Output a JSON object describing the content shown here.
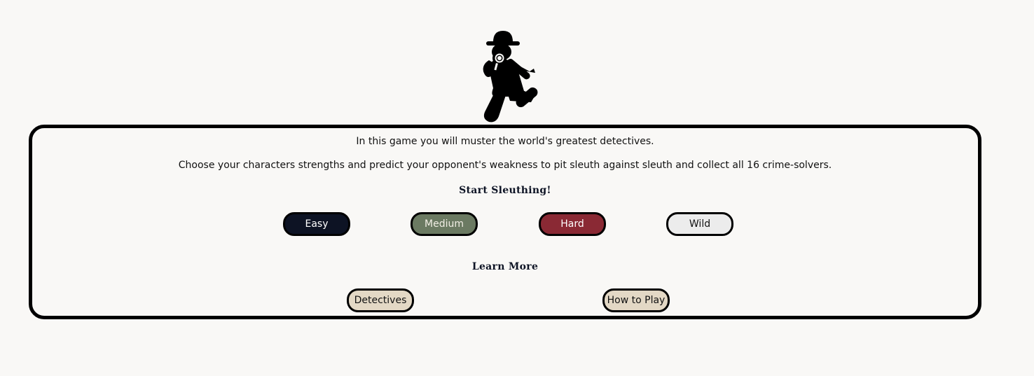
{
  "intro": {
    "line1": "In this game you will muster the world's greatest detectives.",
    "line2": "Choose your characters strengths and predict your opponent's weakness to pit sleuth against sleuth and collect all 16 crime-solvers."
  },
  "start": {
    "heading": "Start Sleuthing!",
    "difficulties": [
      {
        "label": "Easy",
        "color": "#0d1324"
      },
      {
        "label": "Medium",
        "color": "#6b7a62"
      },
      {
        "label": "Hard",
        "color": "#8a2934"
      },
      {
        "label": "Wild",
        "color": "#ececec"
      }
    ]
  },
  "learn": {
    "heading": "Learn More",
    "links": [
      {
        "label": "Detectives"
      },
      {
        "label": "How to Play"
      }
    ]
  },
  "logo": {
    "icon": "detective-icon"
  }
}
